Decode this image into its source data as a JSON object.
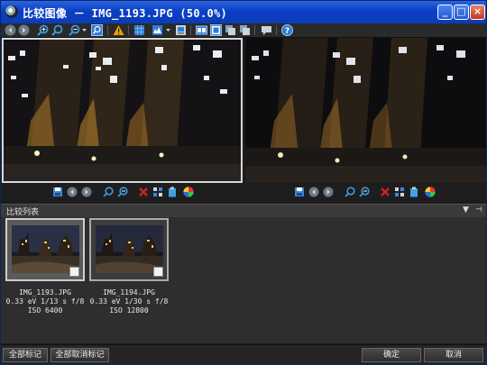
{
  "window": {
    "title": "比较图像 － IMG_1193.JPG (50.0%)",
    "title_prefix": "比较图像",
    "title_file": " － IMG_1193.JPG (50.0%)"
  },
  "toolbar": {
    "icons": [
      "back-icon",
      "forward-icon",
      "zoom-in-icon",
      "zoom-in-alt-icon",
      "zoom-out-icon",
      "dropdown-icon",
      "zoom-fit-icon",
      "warning-icon",
      "grid-icon",
      "levels-icon",
      "export-icon",
      "side-by-side-icon",
      "layout-2-icon",
      "layout-3-icon",
      "layout-4-icon",
      "chat-icon",
      "help-icon"
    ]
  },
  "panel_tools": {
    "icons": [
      "save-icon",
      "prev-icon",
      "next-icon",
      "zoom-in-icon",
      "zoom-out-icon",
      "delete-icon",
      "grid-icon",
      "clipboard-icon",
      "color-icon"
    ]
  },
  "compare_list": {
    "title": "比较列表",
    "pin_glyph": "▼",
    "close_glyph": "⊣"
  },
  "thumbnails": [
    {
      "filename": "IMG_1193.JPG",
      "exposure": "0.33 eV 1/13 s f/8",
      "iso": "ISO 6400",
      "selected": true
    },
    {
      "filename": "IMG_1194.JPG",
      "exposure": "0.33 eV 1/30 s f/8",
      "iso": "ISO 12800",
      "selected": false
    }
  ],
  "buttons": {
    "mark_all": "全部标记",
    "unmark_all": "全部取消标记",
    "ok": "确定",
    "cancel": "取消"
  },
  "colors": {
    "titlebar": "#0a3fc4",
    "accent_blue": "#2f7bd6",
    "warning": "#f0a000",
    "delete": "#d42020"
  }
}
